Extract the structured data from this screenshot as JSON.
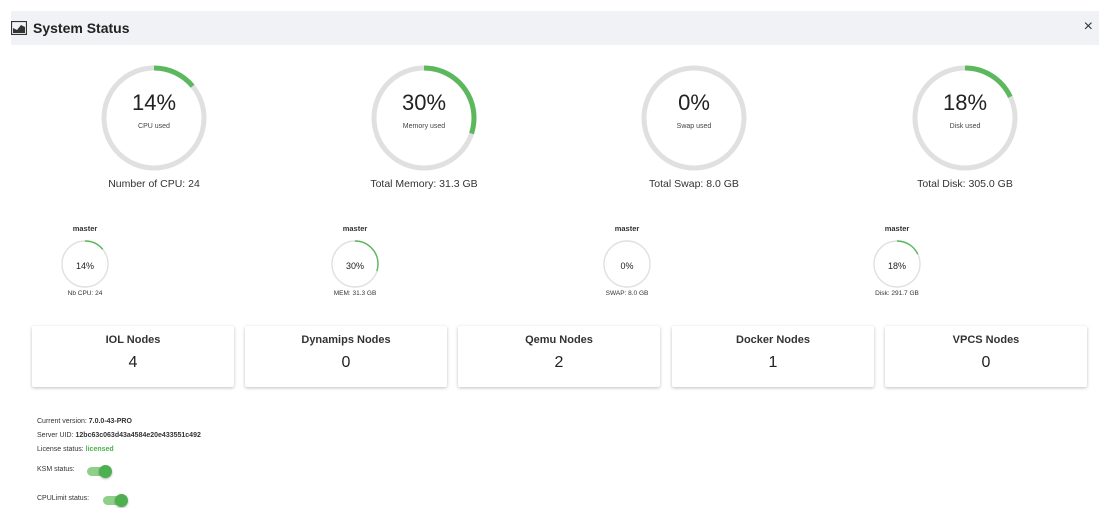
{
  "window": {
    "title": "System Status",
    "close_glyph": "×",
    "icon": "chart-icon"
  },
  "overall": [
    {
      "name": "cpu",
      "percent": 14,
      "percent_label": "14%",
      "sub_label": "CPU used",
      "caption": "Number of CPU: 24"
    },
    {
      "name": "memory",
      "percent": 30,
      "percent_label": "30%",
      "sub_label": "Memory used",
      "caption": "Total Memory: 31.3 GB"
    },
    {
      "name": "swap",
      "percent": 0,
      "percent_label": "0%",
      "sub_label": "Swap used",
      "caption": "Total Swap: 8.0 GB"
    },
    {
      "name": "disk",
      "percent": 18,
      "percent_label": "18%",
      "sub_label": "Disk used",
      "caption": "Total Disk: 305.0 GB"
    }
  ],
  "nodes": [
    {
      "node": "master",
      "percent": 14,
      "percent_label": "14%",
      "caption": "Nb CPU: 24"
    },
    {
      "node": "master",
      "percent": 30,
      "percent_label": "30%",
      "caption": "MEM: 31.3 GB"
    },
    {
      "node": "master",
      "percent": 0,
      "percent_label": "0%",
      "caption": "SWAP: 8.0 GB"
    },
    {
      "node": "master",
      "percent": 18,
      "percent_label": "18%",
      "caption": "Disk: 291.7 GB"
    }
  ],
  "cards": [
    {
      "title": "IOL Nodes",
      "value": "4"
    },
    {
      "title": "Dynamips Nodes",
      "value": "0"
    },
    {
      "title": "Qemu Nodes",
      "value": "2"
    },
    {
      "title": "Docker Nodes",
      "value": "1"
    },
    {
      "title": "VPCS Nodes",
      "value": "0"
    }
  ],
  "info": {
    "version_label": "Current version:",
    "version": "7.0.0-43-PRO",
    "uid_label": "Server UID:",
    "uid": "12bc63c063d43a4584e20e433551c492",
    "license_label": "License status:",
    "license": "licensed",
    "ksm_label": "KSM status:",
    "ksm_on": true,
    "cpulimit_label": "CPULimit status:",
    "cpulimit_on": true
  },
  "colors": {
    "accent": "#5cb85c",
    "track": "#e0e0e0",
    "licensed": "#4caf50"
  }
}
